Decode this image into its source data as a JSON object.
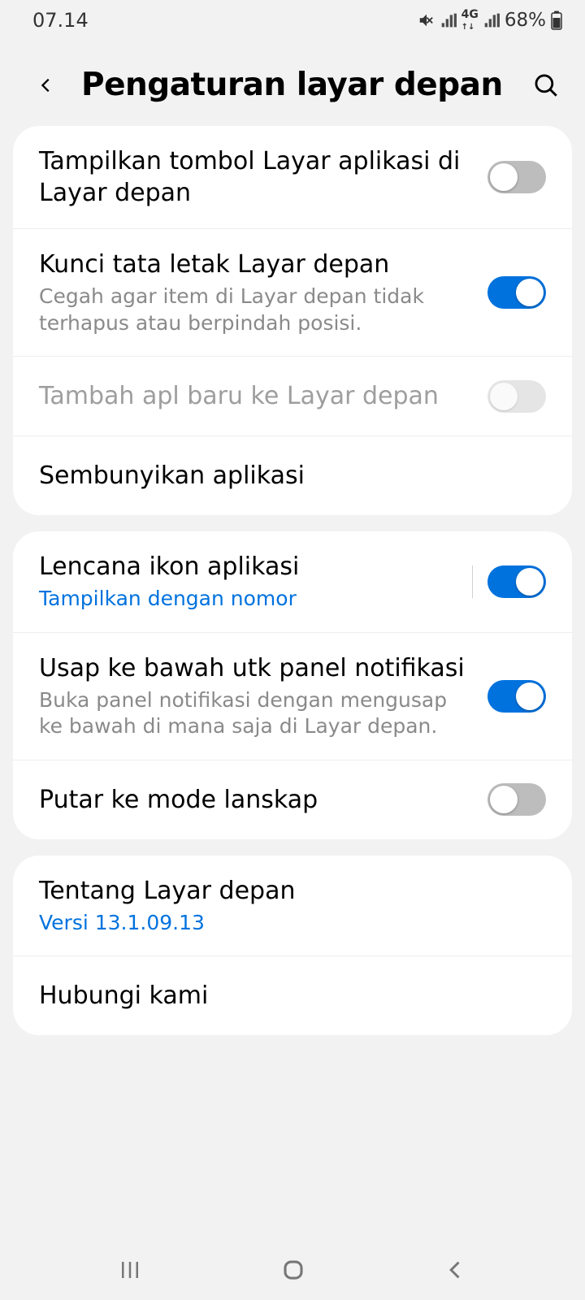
{
  "status_bar": {
    "time": "07.14",
    "battery_text": "68%"
  },
  "header": {
    "title": "Pengaturan layar depan"
  },
  "groups": [
    {
      "rows": [
        {
          "id": "show-apps-button",
          "title": "Tampilkan tombol Layar aplikasi di Layar depan",
          "toggle": "off"
        },
        {
          "id": "lock-layout",
          "title": "Kunci tata letak Layar depan",
          "sub": "Cegah agar item di Layar depan tidak terhapus atau berpindah posisi.",
          "toggle": "on"
        },
        {
          "id": "add-new-apps",
          "title": "Tambah apl baru ke Layar depan",
          "toggle": "disabled",
          "disabled": true
        },
        {
          "id": "hide-apps",
          "title": "Sembunyikan aplikasi"
        }
      ]
    },
    {
      "rows": [
        {
          "id": "app-icon-badges",
          "title": "Lencana ikon aplikasi",
          "sub": "Tampilkan dengan nomor",
          "sublink": true,
          "toggle": "on",
          "divider": true
        },
        {
          "id": "swipe-down-notif",
          "title": "Usap ke bawah utk panel notifikasi",
          "sub": "Buka panel notifikasi dengan mengusap ke bawah di mana saja di Layar depan.",
          "toggle": "on"
        },
        {
          "id": "rotate-landscape",
          "title": "Putar ke mode lanskap",
          "toggle": "off"
        }
      ]
    },
    {
      "rows": [
        {
          "id": "about-home",
          "title": "Tentang Layar depan",
          "sub": "Versi 13.1.09.13",
          "sublink": true
        },
        {
          "id": "contact-us",
          "title": "Hubungi kami"
        }
      ]
    }
  ]
}
